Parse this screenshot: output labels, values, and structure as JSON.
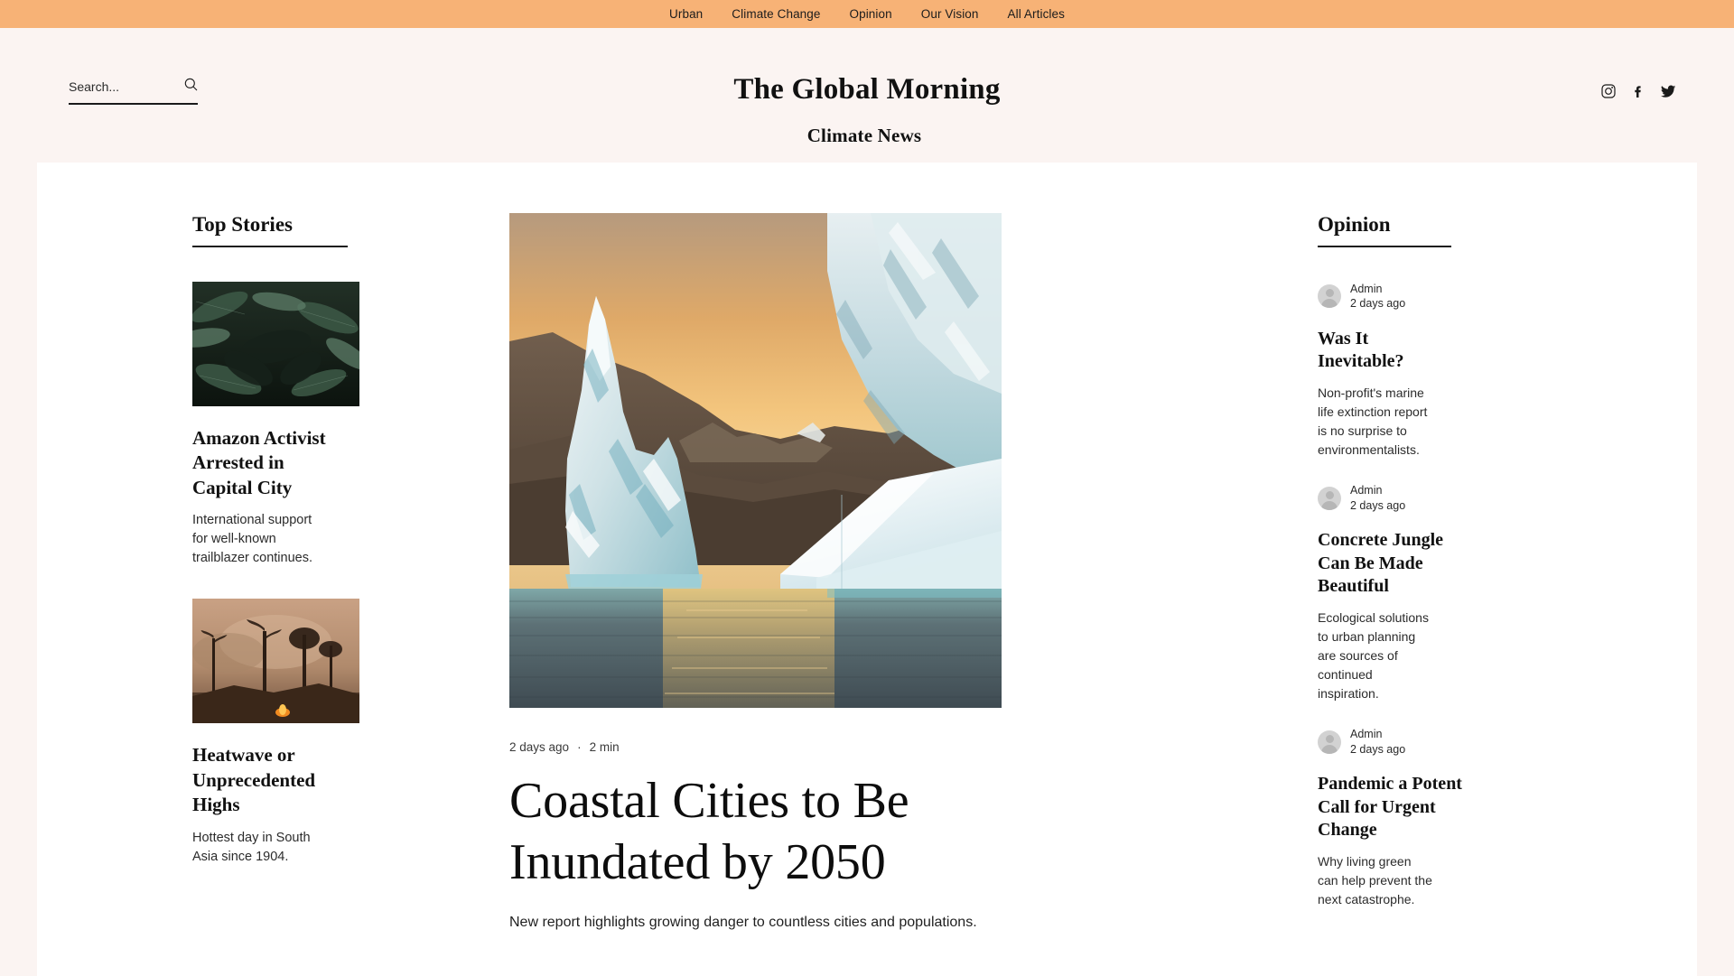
{
  "nav": {
    "items": [
      {
        "label": "Urban"
      },
      {
        "label": "Climate Change"
      },
      {
        "label": "Opinion"
      },
      {
        "label": "Our Vision"
      },
      {
        "label": "All Articles"
      }
    ],
    "background_color": "#f7b276"
  },
  "search": {
    "placeholder": "Search...",
    "value": "",
    "icon": "search-icon"
  },
  "brand": {
    "title": "The Global Morning",
    "subtitle": "Climate News"
  },
  "socials": [
    {
      "name": "instagram-icon"
    },
    {
      "name": "facebook-icon"
    },
    {
      "name": "twitter-icon"
    }
  ],
  "top_stories": {
    "heading": "Top Stories",
    "items": [
      {
        "thumb": "dark-tropical-leaves-photo",
        "title": "Amazon Activist Arrested in Capital City",
        "excerpt": "International support for well-known trailblazer continues."
      },
      {
        "thumb": "forest-wildfire-smoke-photo",
        "title": "Heatwave or Unprecedented Highs",
        "excerpt": "Hottest day in South Asia since 1904."
      }
    ]
  },
  "feature": {
    "image": "iceberg-sunset-fjord-photo",
    "date": "2 days ago",
    "separator": "·",
    "read_time": "2 min",
    "title": "Coastal Cities to Be Inundated by 2050",
    "subtitle": "New report highlights growing danger to countless cities and populations."
  },
  "opinion": {
    "heading": "Opinion",
    "items": [
      {
        "author": "Admin",
        "time": "2 days ago",
        "title": "Was It Inevitable?",
        "excerpt": "Non-profit's marine life extinction report is no surprise to environmentalists."
      },
      {
        "author": "Admin",
        "time": "2 days ago",
        "title": "Concrete Jungle Can Be Made Beautiful",
        "excerpt": "Ecological solutions to urban planning are sources of continued inspiration."
      },
      {
        "author": "Admin",
        "time": "2 days ago",
        "title": "Pandemic a Potent Call for Urgent Change",
        "excerpt": "Why living green can help prevent the next catastrophe."
      }
    ]
  },
  "colors": {
    "nav_bg": "#f7b276",
    "page_bg": "#fbf4f2",
    "canvas_bg": "#ffffff",
    "text": "#111111"
  }
}
